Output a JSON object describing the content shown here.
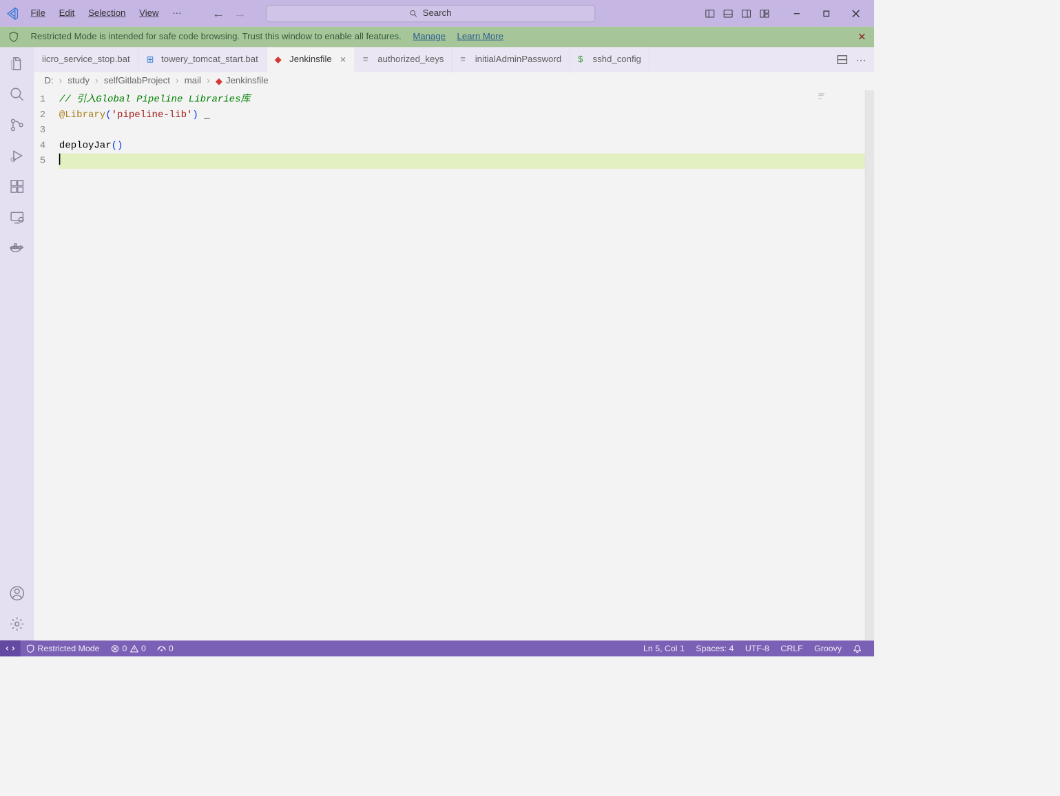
{
  "menubar": {
    "file": "File",
    "edit": "Edit",
    "selection": "Selection",
    "view": "View"
  },
  "search": {
    "placeholder": "Search"
  },
  "notif": {
    "msg": "Restricted Mode is intended for safe code browsing. Trust this window to enable all features.",
    "manage": "Manage",
    "learn": "Learn More"
  },
  "tabs": [
    {
      "label": "iicro_service_stop.bat",
      "icon": "bat",
      "active": false
    },
    {
      "label": "towery_tomcat_start.bat",
      "icon": "win",
      "active": false
    },
    {
      "label": "Jenkinsfile",
      "icon": "jenkins",
      "active": true,
      "closable": true
    },
    {
      "label": "authorized_keys",
      "icon": "text",
      "active": false
    },
    {
      "label": "initialAdminPassword",
      "icon": "text",
      "active": false
    },
    {
      "label": "sshd_config",
      "icon": "conf",
      "active": false
    }
  ],
  "breadcrumb": [
    "D:",
    "study",
    "selfGitlabProject",
    "mail",
    "Jenkinsfile"
  ],
  "code": {
    "l1_comment": "// 引入Global Pipeline Libraries库",
    "l2_ann": "@Library",
    "l2_str": "'pipeline-lib'",
    "l2_suffix": " _",
    "l4_fn": "deployJar",
    "gutter": [
      "1",
      "2",
      "3",
      "4",
      "5"
    ]
  },
  "status": {
    "restricted": "Restricted Mode",
    "errors": "0",
    "warnings": "0",
    "ports": "0",
    "pos": "Ln 5, Col 1",
    "spaces": "Spaces: 4",
    "encoding": "UTF-8",
    "eol": "CRLF",
    "lang": "Groovy"
  }
}
